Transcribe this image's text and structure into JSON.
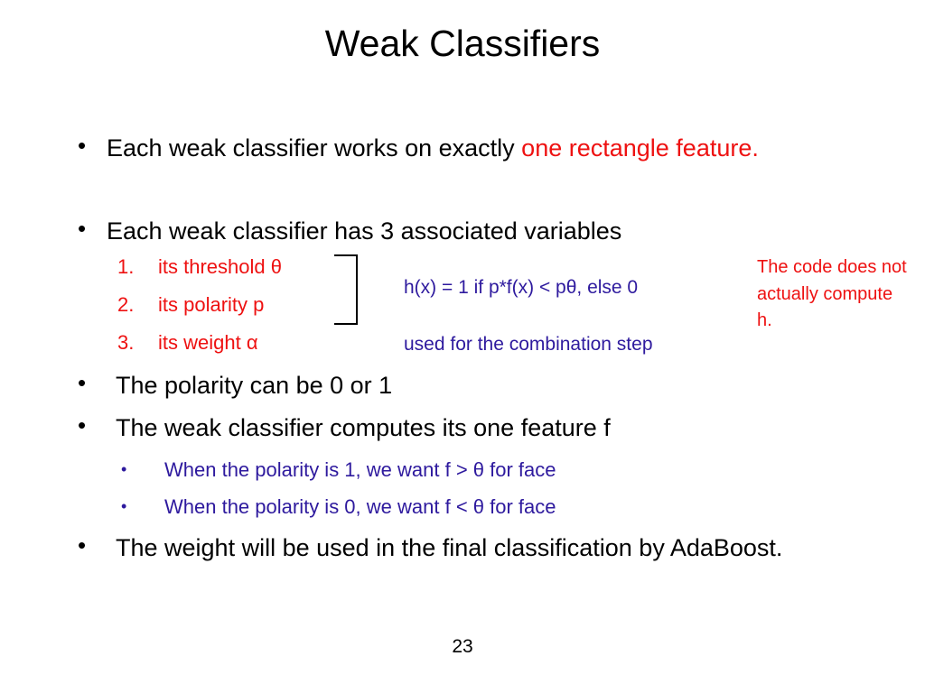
{
  "slide": {
    "title": "Weak Classifiers",
    "page_number": "23",
    "colors": {
      "text": "#000000",
      "accent_red": "#ee1111",
      "accent_blue": "#2e1a9e",
      "background": "#ffffff"
    }
  },
  "bullets": [
    {
      "marker": "•",
      "text_black": "Each weak classifier works on exactly ",
      "text_red": "one rectangle feature."
    },
    {
      "marker": "•",
      "text_black": "Each weak classifier has 3 associated variables"
    },
    {
      "marker": "•",
      "text_black": "The polarity can be 0 or 1"
    },
    {
      "marker": "•",
      "text_black": "The weak classifier computes its one feature f"
    },
    {
      "marker": "•",
      "text_black": "The weight will be used in the final classification by AdaBoost."
    }
  ],
  "numbered_list": [
    {
      "marker": "1.",
      "text": "its threshold θ"
    },
    {
      "marker": "2.",
      "text": "its polarity p"
    },
    {
      "marker": "3.",
      "text": "its weight α"
    }
  ],
  "formula": {
    "equation": "h(x) = 1 if p*f(x) < pθ, else 0",
    "note": "used for the combination step"
  },
  "side_note": {
    "text": "The code does not actually compute h."
  },
  "sub_bullets": [
    {
      "marker": "•",
      "text": "When the polarity is 1, we want f > θ for face"
    },
    {
      "marker": "•",
      "text": "When the polarity is 0, we want f < θ for face"
    }
  ]
}
